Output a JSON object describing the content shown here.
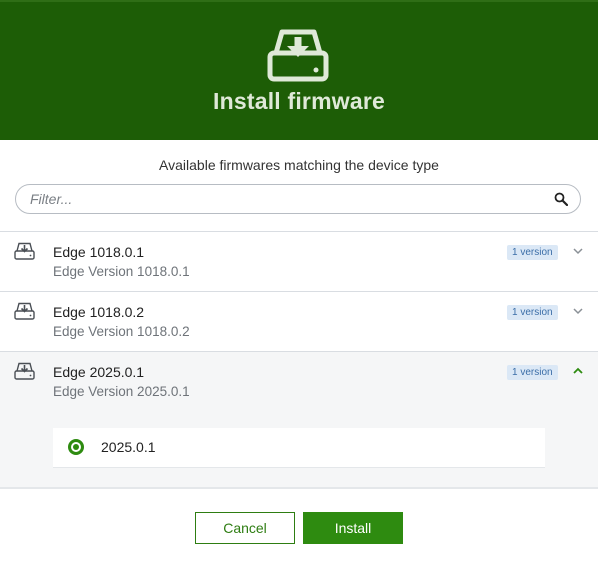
{
  "dialog": {
    "title": "Install firmware",
    "header_icon": "drive-download-icon",
    "subtitle": "Available firmwares matching the device type"
  },
  "filter": {
    "placeholder": "Filter...",
    "value": "",
    "icon": "search-icon"
  },
  "firmwares": [
    {
      "name": "Edge 1018.0.1",
      "description": "Edge Version 1018.0.1",
      "badge": "1 version",
      "expanded": false
    },
    {
      "name": "Edge 1018.0.2",
      "description": "Edge Version 1018.0.2",
      "badge": "1 version",
      "expanded": false
    },
    {
      "name": "Edge 2025.0.1",
      "description": "Edge Version 2025.0.1",
      "badge": "1 version",
      "expanded": true,
      "versions": [
        {
          "label": "2025.0.1",
          "selected": true
        }
      ]
    }
  ],
  "actions": {
    "cancel_label": "Cancel",
    "install_label": "Install"
  },
  "colors": {
    "header_bg": "#1d5d06",
    "accent": "#2e8b10",
    "badge_bg": "#dbe8f6",
    "badge_text": "#3b6ea8"
  }
}
